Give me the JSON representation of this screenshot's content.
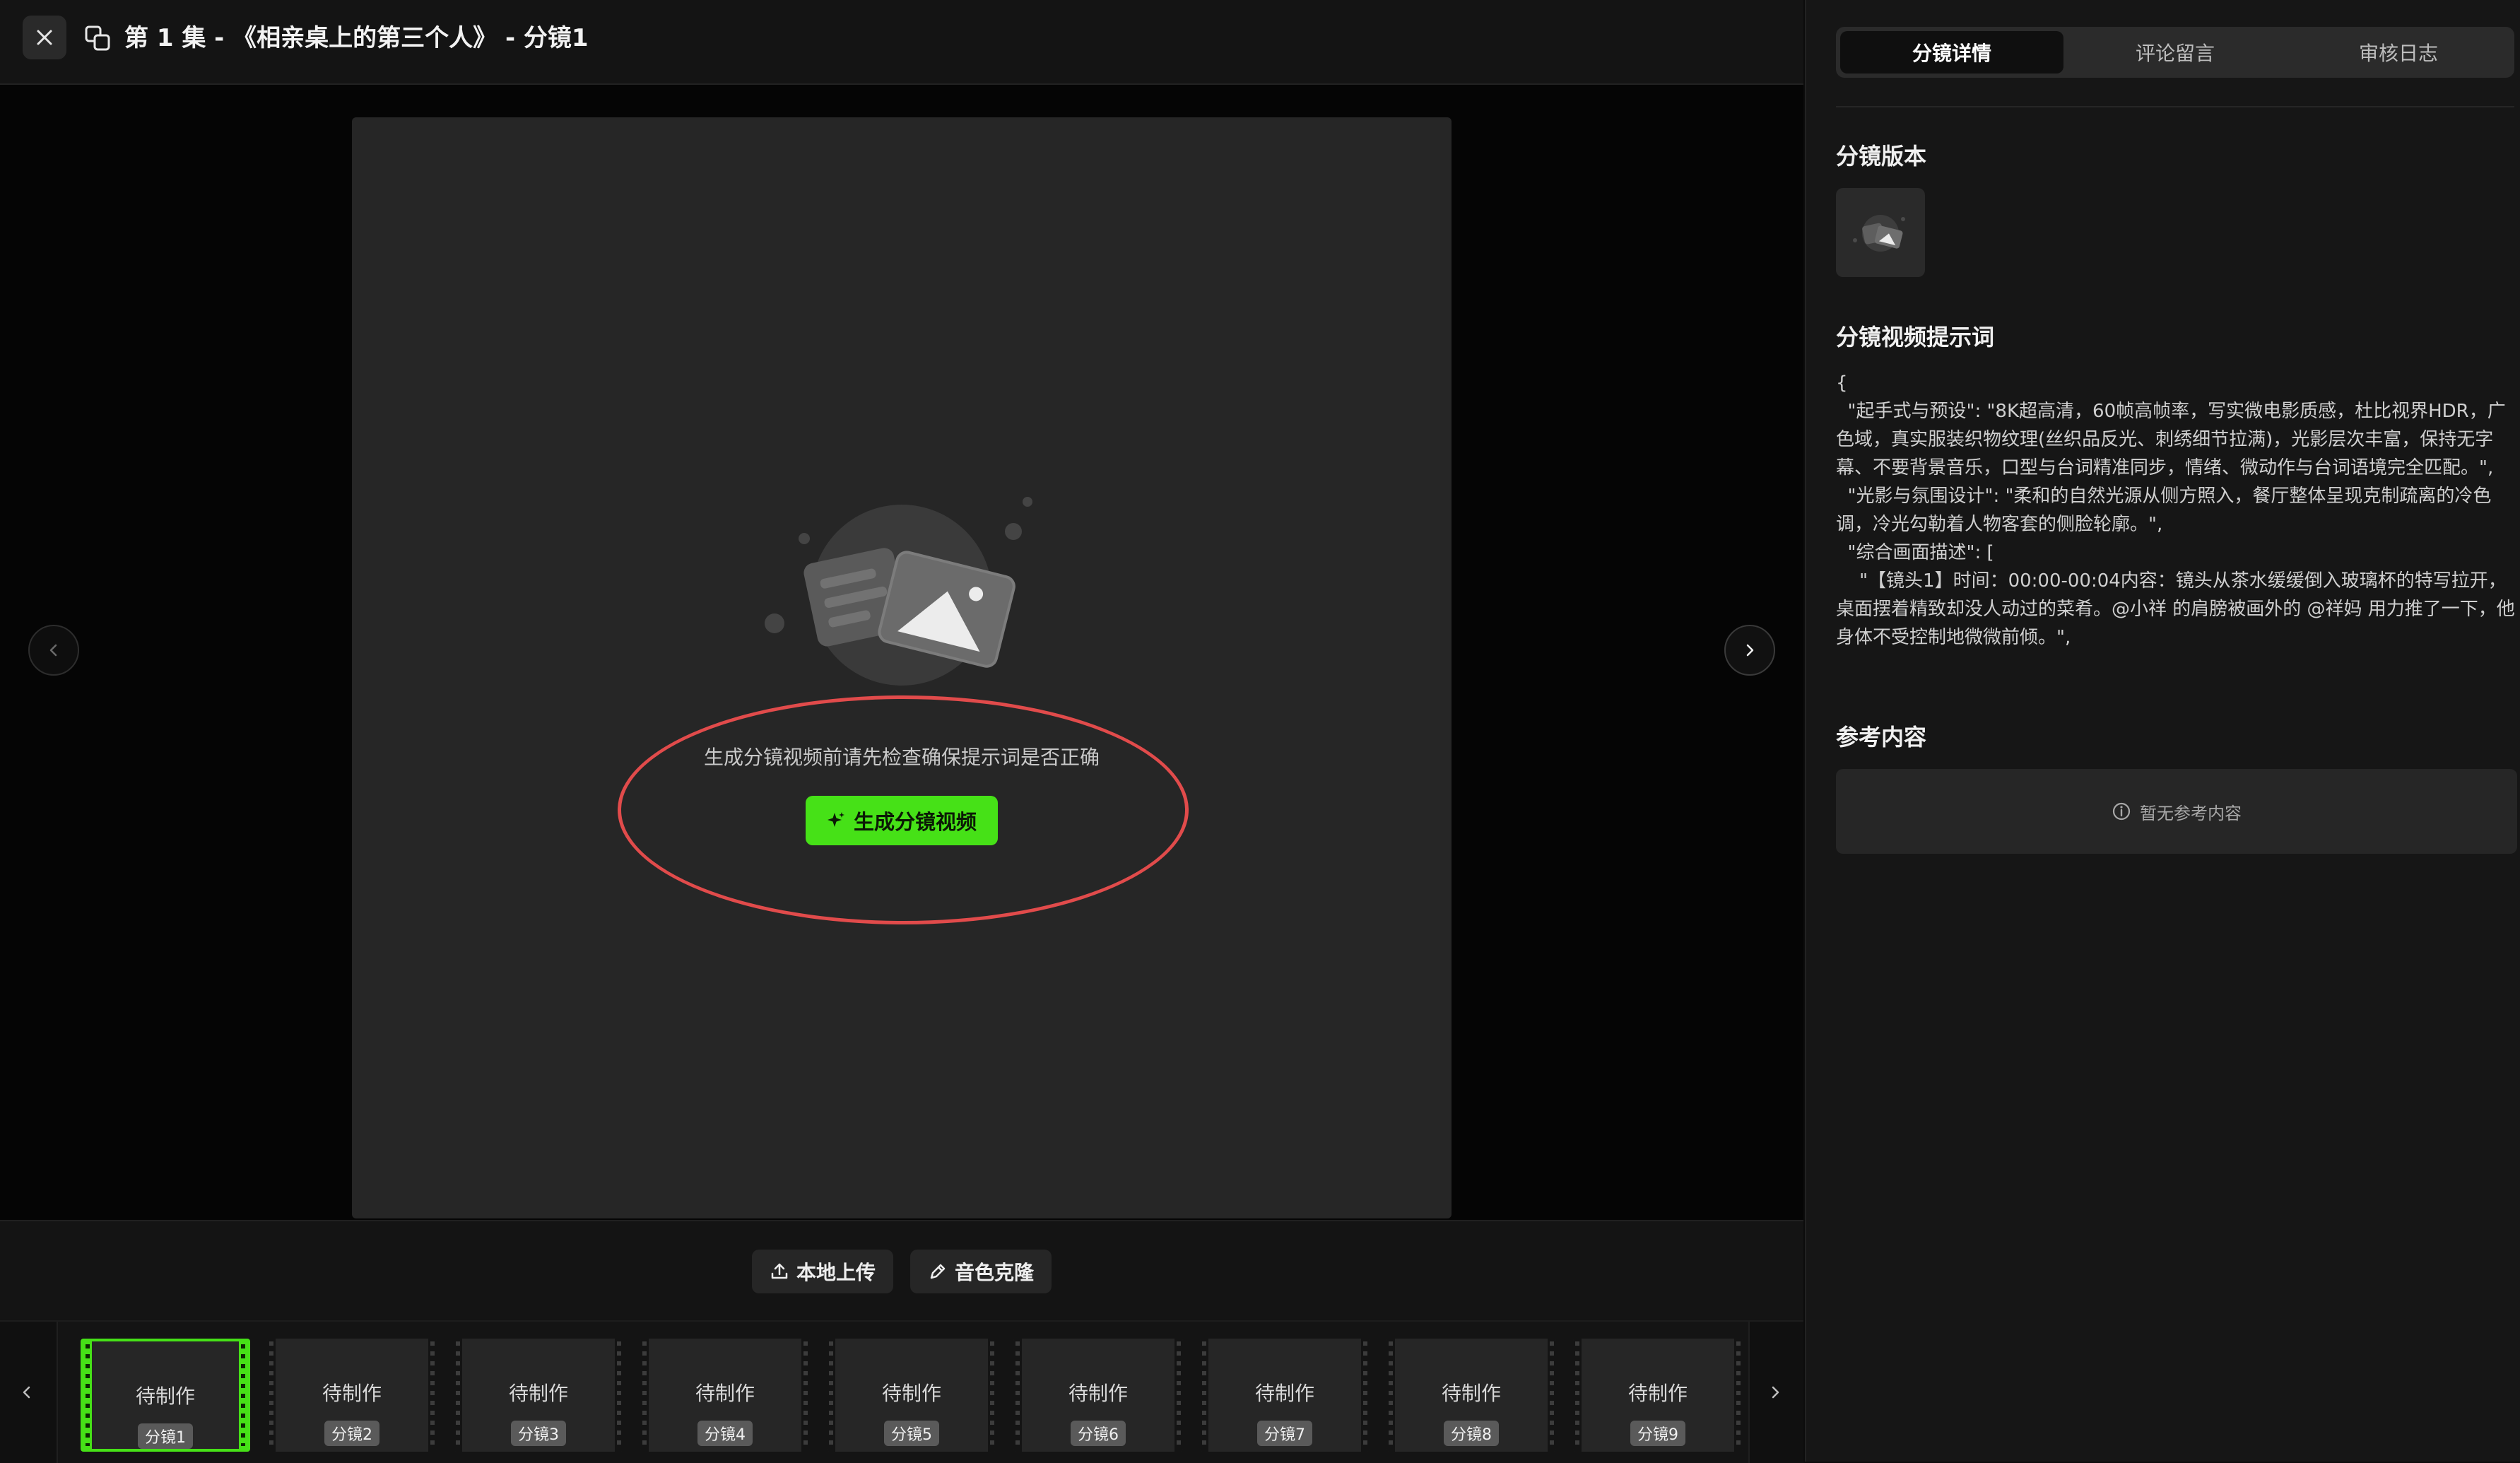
{
  "header": {
    "title": "第 1 集 - 《相亲桌上的第三个人》 - 分镜1",
    "close_icon": "close-icon",
    "shot_icon": "storyboard-icon"
  },
  "preview": {
    "hint": "生成分镜视频前请先检查确保提示词是否正确",
    "generate_label": "生成分镜视频",
    "generate_icon": "sparkle-icon"
  },
  "actions": {
    "upload_label": "本地上传",
    "upload_icon": "upload-icon",
    "clone_label": "音色克隆",
    "clone_icon": "pen-icon"
  },
  "filmstrip": {
    "frames": [
      {
        "status": "待制作",
        "label": "分镜1",
        "active": true
      },
      {
        "status": "待制作",
        "label": "分镜2"
      },
      {
        "status": "待制作",
        "label": "分镜3"
      },
      {
        "status": "待制作",
        "label": "分镜4"
      },
      {
        "status": "待制作",
        "label": "分镜5"
      },
      {
        "status": "待制作",
        "label": "分镜6"
      },
      {
        "status": "待制作",
        "label": "分镜7"
      },
      {
        "status": "待制作",
        "label": "分镜8"
      },
      {
        "status": "待制作",
        "label": "分镜9"
      }
    ]
  },
  "panel": {
    "tabs": [
      {
        "label": "分镜详情",
        "active": true
      },
      {
        "label": "评论留言"
      },
      {
        "label": "审核日志"
      }
    ],
    "version_title": "分镜版本",
    "prompt_title": "分镜视频提示词",
    "prompt_text": "{\n  \"起手式与预设\": \"8K超高清，60帧高帧率，写实微电影质感，杜比视界HDR，广色域，真实服装织物纹理(丝织品反光、刺绣细节拉满)，光影层次丰富，保持无字幕、不要背景音乐，口型与台词精准同步，情绪、微动作与台词语境完全匹配。\",\n  \"光影与氛围设计\": \"柔和的自然光源从侧方照入，餐厅整体呈现克制疏离的冷色调，冷光勾勒着人物客套的侧脸轮廓。\",\n  \"综合画面描述\": [\n    \"【镜头1】时间：00:00-00:04内容：镜头从茶水缓缓倒入玻璃杯的特写拉开，桌面摆着精致却没人动过的菜肴。@小祥 的肩膀被画外的 @祥妈 用力推了一下，他身体不受控制地微微前倾。\",",
    "ref_title": "参考内容",
    "ref_empty": "暂无参考内容",
    "ref_icon": "info-icon"
  },
  "colors": {
    "accent": "#46e117",
    "highlight_ring": "#e14b4b"
  }
}
